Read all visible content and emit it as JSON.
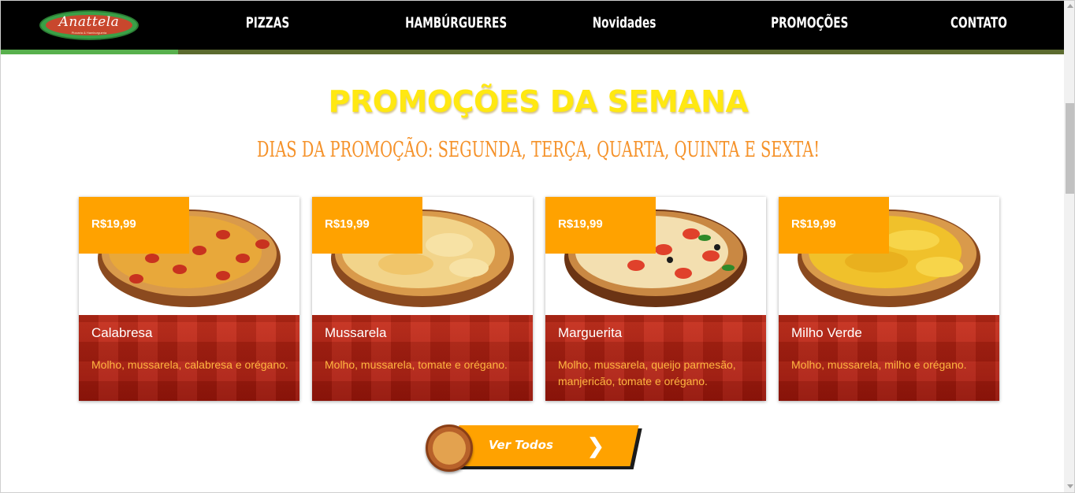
{
  "header": {
    "logo_text": "Anattela",
    "logo_subtext": "Pizzaria & Hamburgueria",
    "nav": [
      {
        "label": "PIZZAS"
      },
      {
        "label": "HAMBÚRGUERES"
      },
      {
        "label": "Novidades"
      },
      {
        "label": "PROMOÇÕES"
      },
      {
        "label": "CONTATO"
      }
    ]
  },
  "section": {
    "title": "PROMOÇÕES DA SEMANA",
    "subtitle": "DIAS DA PROMOÇÃO: SEGUNDA, TERÇA, QUARTA, QUINTA E SEXTA!"
  },
  "cards": [
    {
      "price": "R$19,99",
      "name": "Calabresa",
      "description": "Molho, mussarela, calabresa e orégano.",
      "topping": "pepperoni"
    },
    {
      "price": "R$19,99",
      "name": "Mussarela",
      "description": "Molho, mussarela, tomate e orégano.",
      "topping": "cheese"
    },
    {
      "price": "R$19,99",
      "name": "Marguerita",
      "description": "Molho, mussarela, queijo parmesão, manjericão, tomate e orégano.",
      "topping": "margherita"
    },
    {
      "price": "R$19,99",
      "name": "Milho Verde",
      "description": "Molho, mussarela, milho e orégano.",
      "topping": "corn"
    }
  ],
  "cta": {
    "label": "Ver Todos",
    "icon": "chevron-right-icon"
  },
  "colors": {
    "accent": "#ffa200",
    "title": "#ffe812",
    "subtitle": "#f5922a",
    "card_body": "#b51c0e"
  }
}
